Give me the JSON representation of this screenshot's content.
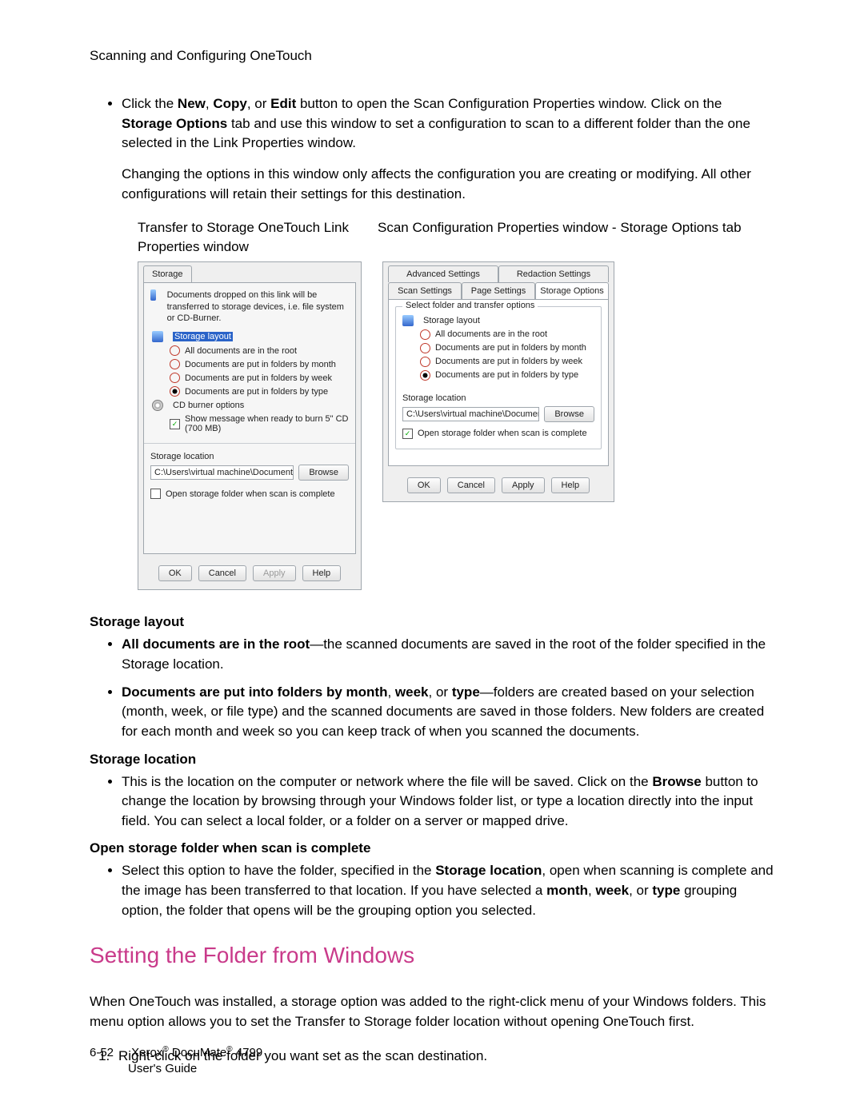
{
  "header": {
    "section": "Scanning and Configuring OneTouch"
  },
  "intro": {
    "b1_pre": "Click the ",
    "b1_new": "New",
    "b1_sep1": ", ",
    "b1_copy": "Copy",
    "b1_sep2": ", or ",
    "b1_edit": "Edit",
    "b1_mid": " button to open the Scan Configuration Properties window. Click on the ",
    "b1_storage": "Storage Options",
    "b1_post": " tab and use this window to set a configuration to scan to a different folder than the one selected in the Link Properties window.",
    "p2": "Changing the options in this window only affects the configuration you are creating or modifying. All other configurations will retain their settings for this destination."
  },
  "captions": {
    "left": "Transfer to Storage OneTouch Link Properties window",
    "right": "Scan Configuration Properties window - Storage Options tab"
  },
  "win1": {
    "tab": "Storage",
    "hint": "Documents dropped on this link will be transferred to storage devices, i.e. file system or CD-Burner.",
    "layout_title": "Storage layout",
    "opt_root": "All documents are in the root",
    "opt_month": "Documents are put in folders by month",
    "opt_week": "Documents are put in folders by week",
    "opt_type": "Documents are put in folders by type",
    "cd_title": "CD burner options",
    "cd_opt": "Show message when ready to burn 5\" CD (700 MB)",
    "loc_title": "Storage location",
    "loc_path": "C:\\Users\\virtual machine\\Documents\\My OneTou",
    "browse": "Browse",
    "open_chk": "Open storage folder when scan is complete",
    "ok": "OK",
    "cancel": "Cancel",
    "apply": "Apply",
    "help": "Help"
  },
  "win2": {
    "tab_adv": "Advanced Settings",
    "tab_red": "Redaction Settings",
    "tab_scan": "Scan Settings",
    "tab_page": "Page Settings",
    "tab_storage": "Storage Options",
    "group_title": "Select folder and transfer options",
    "layout_title": "Storage layout",
    "opt_root": "All documents are in the root",
    "opt_month": "Documents are put in folders by month",
    "opt_week": "Documents are put in folders by week",
    "opt_type": "Documents are put in folders by type",
    "loc_title": "Storage location",
    "loc_path": "C:\\Users\\virtual machine\\Documents\\My OneTouch",
    "browse": "Browse",
    "open_chk": "Open storage folder when scan is complete",
    "ok": "OK",
    "cancel": "Cancel",
    "apply": "Apply",
    "help": "Help"
  },
  "defs": {
    "h_layout": "Storage layout",
    "root_b": "All documents are in the root",
    "root_t": "—the scanned documents are saved in the root of the folder specified in the Storage location.",
    "fold_b": "Documents are put into folders by month",
    "fold_sep1": ", ",
    "fold_b2": "week",
    "fold_sep2": ", or ",
    "fold_b3": "type",
    "fold_t": "—folders are created based on your selection (month, week, or file type) and the scanned documents are saved in those folders. New folders are created for each month and week so you can keep track of when you scanned the documents.",
    "h_loc": "Storage location",
    "loc_pre": "This is the location on the computer or network where the file will be saved. Click on the ",
    "loc_browse": "Browse",
    "loc_post": " button to change the location by browsing through your Windows folder list, or type a location directly into the input field. You can select a local folder, or a folder on a server or mapped drive.",
    "h_open": "Open storage folder when scan is complete",
    "open_pre": "Select this option to have the folder, specified in the ",
    "open_b1": "Storage location",
    "open_mid": ", open when scanning is complete and the image has been transferred to that location. If you have selected a ",
    "open_b2": "month",
    "open_sep1": ", ",
    "open_b3": "week",
    "open_sep2": ", or ",
    "open_b4": "type",
    "open_post": " grouping option, the folder that opens will be the grouping option you selected."
  },
  "h2": "Setting the Folder from Windows",
  "p_after": "When OneTouch was installed, a storage option was added to the right-click menu of your Windows folders. This menu option allows you to set the Transfer to Storage folder location without opening OneTouch first.",
  "step1": "Right-click on the folder you want set as the scan destination.",
  "footer": {
    "pn": "6-52",
    "line1a": "Xerox",
    "line1b": " DocuMate",
    "line1c": " 4799",
    "line2": "User's Guide"
  }
}
